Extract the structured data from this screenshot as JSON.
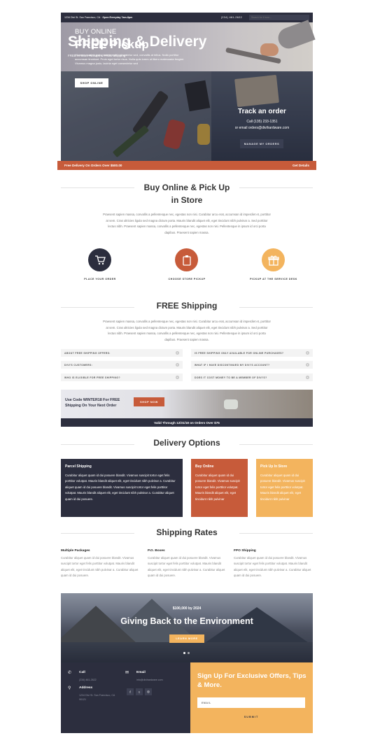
{
  "topbar": {
    "address": "1234 Divi St. San Francisco, CA",
    "hours": "Open Everyday 7am-8pm",
    "phone": "(234) 461-2622",
    "search_placeholder": "Search for it here..."
  },
  "hero": {
    "title": "Shipping & Delivery",
    "subtitle": "FREE In Store Pickups & FREE Shipping*"
  },
  "buy_online": {
    "label": "BUY ONLINE",
    "title": "FREE Pickup",
    "body": "Vivamus magna justo, lacinia eget consectetur sed, convallis at tellus. Nulla porttitor accumsan tincidunt. Proin eget tortor risus. Nulla quis lorem ut libero malesuada feugiat. Vivamus magna justo, lacinia eget consectetur sed",
    "button": "SHOP ONLINE"
  },
  "track": {
    "title": "Track an order",
    "call": "Call (135) 233-1351",
    "email": "or email orders@divihardware.com",
    "button": "MANAGE MY ORDERS"
  },
  "promo_bar": {
    "text": "Free Delivery On Orders Over $500.00",
    "link": "Get Details"
  },
  "pickup_section": {
    "title_line1": "Buy Online & Pick Up",
    "title_line2": "in Store",
    "paragraph": "Praesent sapien massa, convallis a pellentesque nec, egestas non nisi. Curabitur arcu erat, accumsan id imperdiet et, porttitor at sem. Cras ultricies ligula sed magna dictum porta. Mauris blandit aliquet elit, eget tincidunt nibh pulvinar a. Sed porttitor lectus nibh. Praesent sapien massa, convallis a pellentesque nec, egestas non nisi. Pellentesque in ipsum id orci porta dapibus. Praesent sapien massa.",
    "steps": [
      {
        "label": "PLACE YOUR ORDER",
        "icon": "cart-icon",
        "color": "#2c2e3e"
      },
      {
        "label": "CHOOSE STORE PICKUP",
        "icon": "clipboard-icon",
        "color": "#c75b3a"
      },
      {
        "label": "PICKUP AT THE SERVICE DESK",
        "icon": "gift-icon",
        "color": "#f3b45e"
      }
    ]
  },
  "free_shipping": {
    "title": "FREE Shipping",
    "paragraph": "Praesent sapien massa, convallis a pellentesque nec, egestas non nisi. Curabitur arcu erat, accumsan id imperdiet et, porttitor at sem. Cras ultricies ligula sed magna dictum porta. Mauris blandit aliquet elit, eget tincidunt nibh pulvinar a. Sed porttitor lectus nibh. Praesent sapien massa, convallis a pellentesque nec, egestas non nisi. Pellentesque in ipsum id orci porta dapibus. Praesent sapien massa.",
    "faq_left": [
      "ABOUT FREE SHIPPING OFFERS:",
      "DIVI'S CUSTOMERS:",
      "WHO IS ELIGIBLE FOR FREE SHIPPING?"
    ],
    "faq_right": [
      "IS FREE SHIPPING ONLY AVAILABLE FOR ONLINE PURCHASES?",
      "WHAT IF I HAVE DISCONTINUED MY DIVI'S ACCOUNT?",
      "DOES IT COST MONEY TO BE A MEMBER OF DIVI'S?"
    ]
  },
  "coupon": {
    "text_line1": "Use Code WINTER18 For FREE",
    "text_line2": "Shipping On Your Next Order",
    "button": "SHOP NOW",
    "bar": "Valid Through 12/31/18 on Orders Over $75"
  },
  "delivery": {
    "title": "Delivery Options",
    "options": [
      {
        "title": "Parcel Shipping",
        "body": "Curabitur aliquet quam id dui posuere blandit. Vivamus suscipit tortor eget felis porttitor volutpat. Mauris blandit aliquet elit, eget tincidunt nibh pulvinar a. Curabitur aliquet quam id dui posuere blandit. Vivamus suscipit tortor eget felis porttitor volutpat. Mauris blandit aliquet elit, eget tincidunt nibh pulvinar a. Curabitur aliquet quam id dui posuere.",
        "color": "#2c2e3e"
      },
      {
        "title": "Buy Online",
        "body": "Curabitur aliquet quam id dui posuere blandit. Vivamus suscipit tortor eget felis porttitor volutpat. Mauris blandit aliquet elit, eget tincidunt nibh pulvinar",
        "color": "#c75b3a"
      },
      {
        "title": "Pick Up In Store",
        "body": "Curabitur aliquet quam id dui posuere blandit. Vivamus suscipit tortor eget felis porttitor volutpat. Mauris blandit aliquet elit, eget tincidunt nibh pulvinar",
        "color": "#f3b45e"
      }
    ]
  },
  "rates": {
    "title": "Shipping Rates",
    "items": [
      {
        "title": "Multiple Packages",
        "body": "Curabitur aliquet quam id dui posuere blandit. Vivamus suscipit tortor eget felis porttitor volutpat. Mauris blandit aliquet elit, eget tincidunt nibh pulvinar a. Curabitur aliquet quam id dui posuere."
      },
      {
        "title": "P.O. Boxes",
        "body": "Curabitur aliquet quam id dui posuere blandit. Vivamus suscipit tortor eget felis porttitor volutpat. Mauris blandit aliquet elit, eget tincidunt nibh pulvinar a. Curabitur aliquet quam id dui posuere."
      },
      {
        "title": "FPO Shipping",
        "body": "Curabitur aliquet quam id dui posuere blandit. Vivamus suscipit tortor eget felis porttitor volutpat. Mauris blandit aliquet elit, eget tincidunt nibh pulvinar a. Curabitur aliquet quam id dui posuere."
      }
    ]
  },
  "environment": {
    "eyebrow": "$100,000 by 2024",
    "title": "Giving Back to the Environment",
    "button": "LEARN MORE"
  },
  "footer": {
    "call_label": "Call",
    "call_value": "(234) 461-2622",
    "email_label": "Email",
    "email_value": "info@divihardware.com",
    "address_label": "Address",
    "address_line1": "1234 Divi St. San Francisco, CA",
    "address_line2": "90121",
    "social": [
      "f",
      "t",
      "◎"
    ],
    "signup_title": "Sign Up For Exclusive Offers, Tips & More.",
    "email_placeholder": "EMAIL",
    "submit": "SUBMIT"
  },
  "colors": {
    "navy": "#2c2e3e",
    "rust": "#c75b3a",
    "gold": "#f3b45e"
  }
}
